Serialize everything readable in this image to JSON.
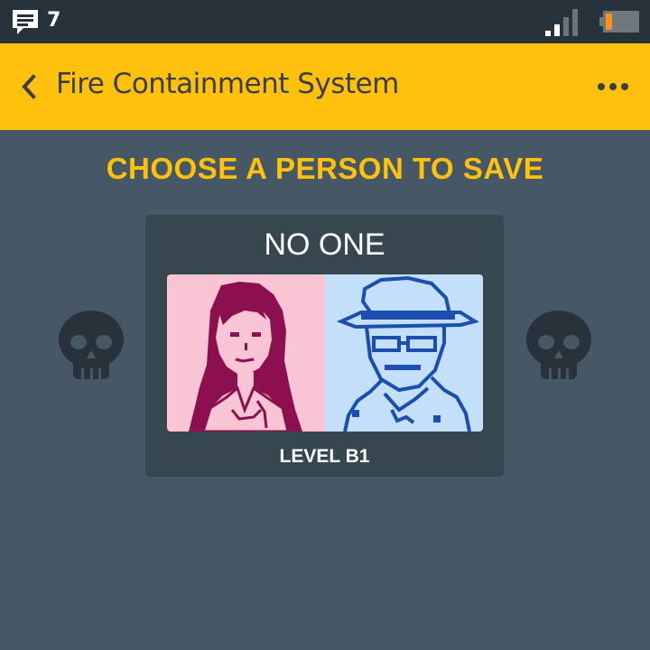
{
  "status_bar": {
    "notification_count": "7",
    "icons": [
      "message-icon",
      "signal-icon",
      "battery-icon"
    ],
    "battery_color": "#ff8c1a"
  },
  "app_bar": {
    "title": "Fire Containment System",
    "back_icon": "chevron-left-icon",
    "menu_icon": "more-horizontal-icon",
    "color": "#ffc10d"
  },
  "main": {
    "headline": "CHOOSE A PERSON TO SAVE",
    "card": {
      "title": "NO ONE",
      "level": "LEVEL B1",
      "left_portrait": "woman-portrait",
      "right_portrait": "man-in-hat-portrait",
      "left_color": "#8c1050",
      "right_color": "#1a4fb0"
    },
    "side_icons": [
      "skull-icon",
      "skull-icon"
    ]
  }
}
